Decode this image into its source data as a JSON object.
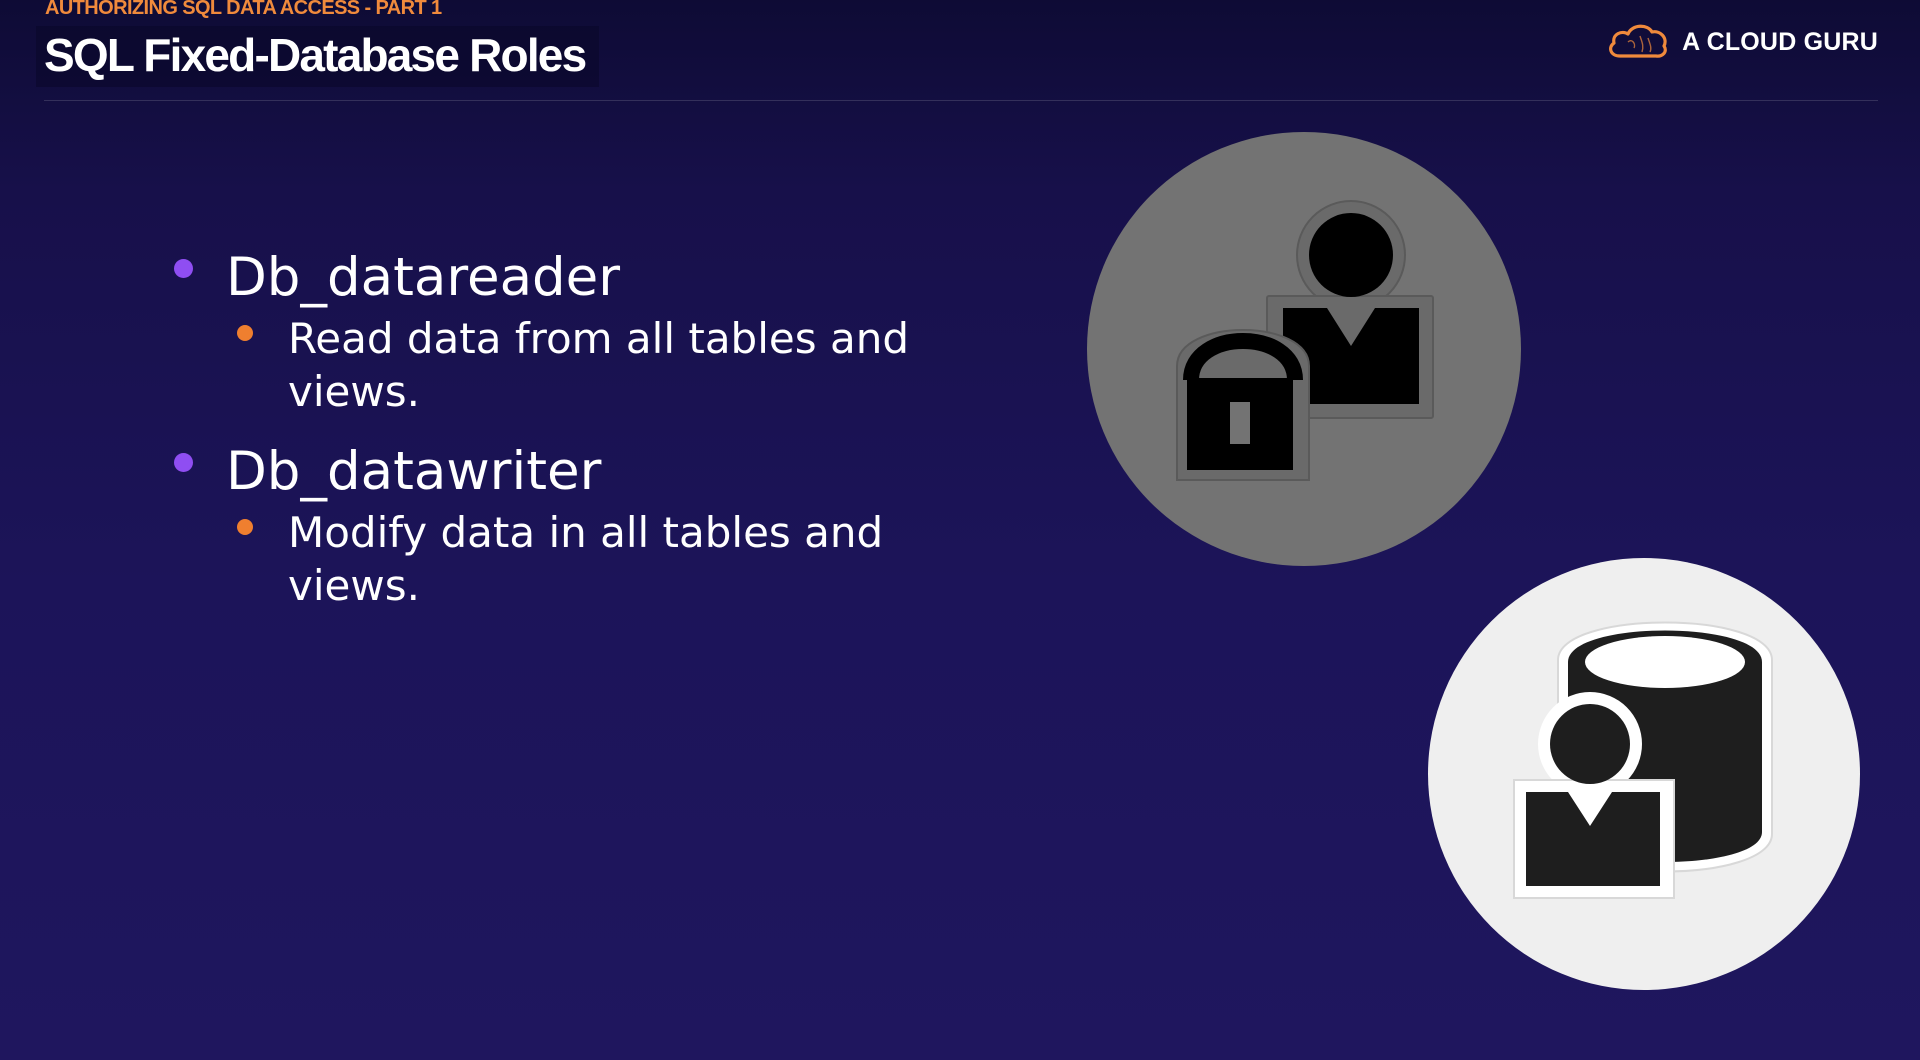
{
  "header": {
    "kicker": "AUTHORIZING SQL DATA ACCESS - PART 1",
    "title": "SQL Fixed-Database Roles"
  },
  "logo": {
    "text": "A CLOUD GURU",
    "icon": "cloud-logo-icon",
    "color": "#f08a3c"
  },
  "bullets": [
    {
      "label": "Db_datareader",
      "sub": "Read data from all tables and views."
    },
    {
      "label": "Db_datawriter",
      "sub": "Modify data in all tables and views."
    }
  ],
  "illustrations": [
    {
      "icon": "user-lock-icon",
      "background": "#737373"
    },
    {
      "icon": "database-user-icon",
      "background": "#efefef"
    }
  ],
  "colors": {
    "background": "#1c1459",
    "accent_orange": "#ef7f2f",
    "accent_purple": "#8f4ef2"
  }
}
